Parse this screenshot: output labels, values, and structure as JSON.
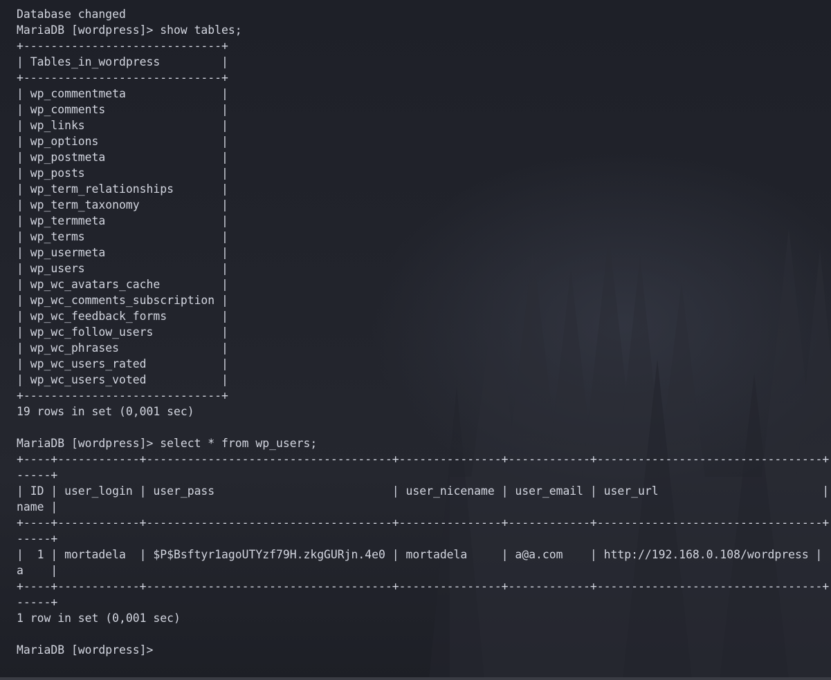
{
  "terminal": {
    "lines": [
      "Database changed",
      "MariaDB [wordpress]> show tables;",
      "+-----------------------------+",
      "| Tables_in_wordpress         |",
      "+-----------------------------+",
      "| wp_commentmeta              |",
      "| wp_comments                 |",
      "| wp_links                    |",
      "| wp_options                  |",
      "| wp_postmeta                 |",
      "| wp_posts                    |",
      "| wp_term_relationships       |",
      "| wp_term_taxonomy            |",
      "| wp_termmeta                 |",
      "| wp_terms                    |",
      "| wp_usermeta                 |",
      "| wp_users                    |",
      "| wp_wc_avatars_cache         |",
      "| wp_wc_comments_subscription |",
      "| wp_wc_feedback_forms        |",
      "| wp_wc_follow_users          |",
      "| wp_wc_phrases               |",
      "| wp_wc_users_rated           |",
      "| wp_wc_users_voted           |",
      "+-----------------------------+",
      "19 rows in set (0,001 sec)",
      "",
      "MariaDB [wordpress]> select * from wp_users;",
      "+----+------------+------------------------------------+---------------+------------+---------------------------------+",
      "-----+",
      "| ID | user_login | user_pass                          | user_nicename | user_email | user_url                        |",
      "name |",
      "+----+------------+------------------------------------+---------------+------------+---------------------------------+",
      "-----+",
      "|  1 | mortadela  | $P$Bsftyr1agoUTYzf79H.zkgGURjn.4e0 | mortadela     | a@a.com    | http://192.168.0.108/wordpress |",
      "a    |",
      "+----+------------+------------------------------------+---------------+------------+---------------------------------+",
      "-----+",
      "1 row in set (0,001 sec)",
      "",
      "MariaDB [wordpress]> "
    ]
  }
}
